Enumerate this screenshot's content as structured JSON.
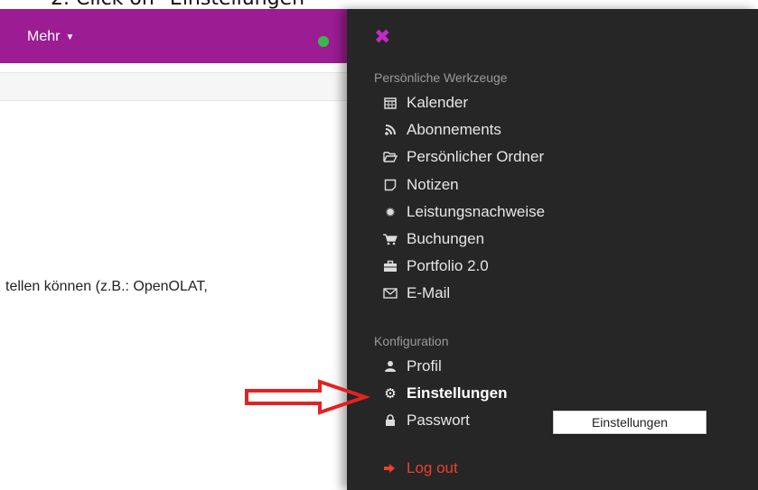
{
  "caption": "2.  Click on \"Einstellungen\"",
  "topbar": {
    "menu_label": "Mehr",
    "status_color": "#3cb84a",
    "bg": "#9c1c93"
  },
  "content": {
    "text": "tellen können (z.B.: OpenOLAT,"
  },
  "panel": {
    "close_icon": "close-icon",
    "sections": [
      {
        "title": "Persönliche Werkzeuge",
        "items": [
          {
            "label": "Kalender",
            "icon": "calendar-icon"
          },
          {
            "label": "Abonnements",
            "icon": "rss-icon"
          },
          {
            "label": "Persönlicher Ordner",
            "icon": "folder-open-icon"
          },
          {
            "label": "Notizen",
            "icon": "note-icon"
          },
          {
            "label": "Leistungsnachweise",
            "icon": "certificate-icon"
          },
          {
            "label": "Buchungen",
            "icon": "cart-icon"
          },
          {
            "label": "Portfolio 2.0",
            "icon": "briefcase-icon"
          },
          {
            "label": "E-Mail",
            "icon": "envelope-icon"
          }
        ]
      },
      {
        "title": "Konfiguration",
        "items": [
          {
            "label": "Profil",
            "icon": "user-icon"
          },
          {
            "label": "Einstellungen",
            "icon": "cogs-icon",
            "active": true
          },
          {
            "label": "Passwort",
            "icon": "lock-icon"
          }
        ]
      }
    ],
    "logout_label": "Log out",
    "tooltip": "Einstellungen"
  },
  "colors": {
    "panel_bg": "#262626",
    "close": "#c02bbf",
    "logout": "#e8412f",
    "arrow": "#e32222"
  }
}
